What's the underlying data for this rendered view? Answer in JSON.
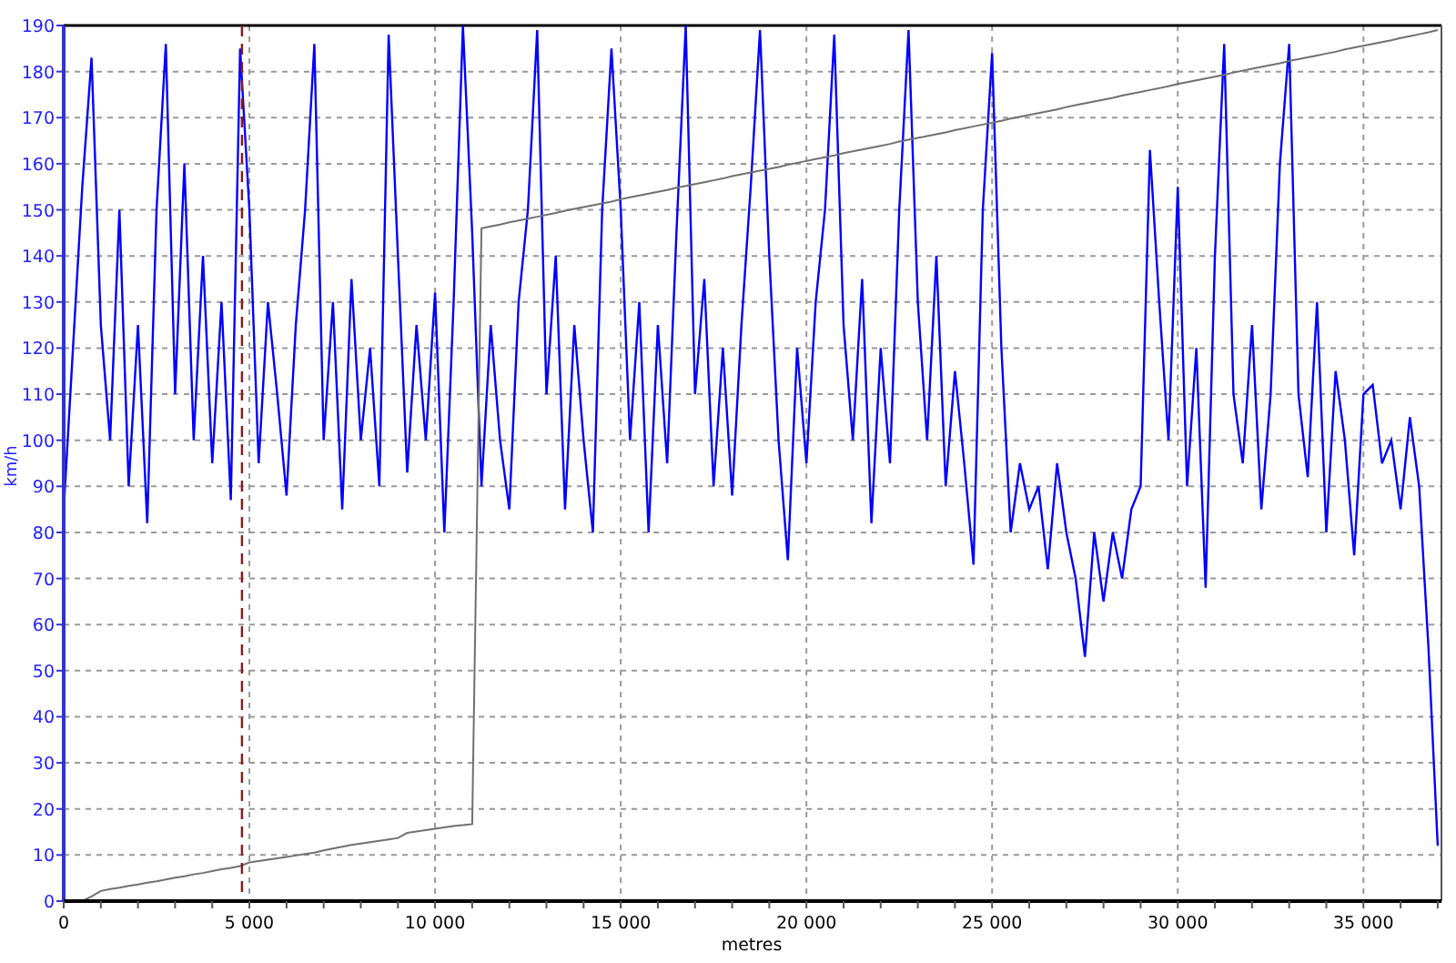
{
  "plot": {
    "chart_data": {
      "type": "line",
      "xlabel": "metres",
      "ylabel": "km/h",
      "xlim": [
        0,
        37100
      ],
      "ylim": [
        0,
        190
      ],
      "xticks": [
        {
          "value": 0,
          "label": "0"
        },
        {
          "value": 5000,
          "label": "5 000"
        },
        {
          "value": 10000,
          "label": "10 000"
        },
        {
          "value": 15000,
          "label": "15 000"
        },
        {
          "value": 20000,
          "label": "20 000"
        },
        {
          "value": 25000,
          "label": "25 000"
        },
        {
          "value": 30000,
          "label": "30 000"
        },
        {
          "value": 35000,
          "label": "35 000"
        }
      ],
      "yticks": [
        0,
        10,
        20,
        30,
        40,
        50,
        60,
        70,
        80,
        90,
        100,
        110,
        120,
        130,
        140,
        150,
        160,
        170,
        180,
        190
      ],
      "x": [
        0,
        250,
        500,
        750,
        1000,
        1250,
        1500,
        1750,
        2000,
        2250,
        2500,
        2750,
        3000,
        3250,
        3500,
        3750,
        4000,
        4250,
        4500,
        4750,
        5000,
        5250,
        5500,
        5750,
        6000,
        6250,
        6500,
        6750,
        7000,
        7250,
        7500,
        7750,
        8000,
        8250,
        8500,
        8750,
        9000,
        9250,
        9500,
        9750,
        10000,
        10250,
        10500,
        10750,
        11000,
        11250,
        11500,
        11750,
        12000,
        12250,
        12500,
        12750,
        13000,
        13250,
        13500,
        13750,
        14000,
        14250,
        14500,
        14750,
        15000,
        15250,
        15500,
        15750,
        16000,
        16250,
        16500,
        16750,
        17000,
        17250,
        17500,
        17750,
        18000,
        18250,
        18500,
        18750,
        19000,
        19250,
        19500,
        19750,
        20000,
        20250,
        20500,
        20750,
        21000,
        21250,
        21500,
        21750,
        22000,
        22250,
        22500,
        22750,
        23000,
        23250,
        23500,
        23750,
        24000,
        24250,
        24500,
        24750,
        25000,
        25250,
        25500,
        25750,
        26000,
        26250,
        26500,
        26750,
        27000,
        27250,
        27500,
        27750,
        28000,
        28250,
        28500,
        28750,
        29000,
        29250,
        29500,
        29750,
        30000,
        30250,
        30500,
        30750,
        31000,
        31250,
        31500,
        31750,
        32000,
        32250,
        32500,
        32750,
        33000,
        33250,
        33500,
        33750,
        34000,
        34250,
        34500,
        34750,
        35000,
        35250,
        35500,
        35750,
        36000,
        36250,
        36500,
        36750,
        37000
      ],
      "series": [
        {
          "color": "#0000ff",
          "values": [
            85,
            120,
            155,
            183,
            125,
            100,
            150,
            90,
            125,
            82,
            150,
            186,
            110,
            160,
            100,
            140,
            95,
            130,
            87,
            185,
            150,
            95,
            130,
            110,
            88,
            125,
            150,
            186,
            100,
            130,
            85,
            135,
            100,
            120,
            90,
            188,
            140,
            93,
            125,
            100,
            132,
            80,
            130,
            190,
            145,
            90,
            125,
            100,
            85,
            130,
            150,
            189,
            110,
            140,
            85,
            125,
            100,
            80,
            150,
            185,
            150,
            100,
            130,
            80,
            125,
            95,
            145,
            190,
            110,
            135,
            90,
            120,
            88,
            125,
            155,
            189,
            140,
            100,
            74,
            120,
            95,
            130,
            150,
            188,
            125,
            100,
            135,
            82,
            120,
            95,
            150,
            189,
            130,
            100,
            140,
            90,
            115,
            95,
            73,
            150,
            184,
            120,
            80,
            95,
            85,
            90,
            72,
            95,
            80,
            70,
            53,
            80,
            65,
            80,
            70,
            85,
            90,
            163,
            130,
            100,
            155,
            90,
            120,
            68,
            140,
            186,
            110,
            95,
            125,
            85,
            110,
            160,
            186,
            110,
            92,
            130,
            80,
            115,
            100,
            75,
            110,
            112,
            95,
            100,
            85,
            105,
            90,
            55,
            12
          ]
        },
        {
          "color": "#707070",
          "values": [
            0,
            0,
            0,
            1,
            2.2,
            2.6,
            2.9,
            3.3,
            3.6,
            4.0,
            4.3,
            4.7,
            5.1,
            5.4,
            5.8,
            6.1,
            6.5,
            6.9,
            7.2,
            7.6,
            8.4,
            8.7,
            9.0,
            9.3,
            9.6,
            9.9,
            10.2,
            10.5,
            11.0,
            11.4,
            11.8,
            12.2,
            12.5,
            12.8,
            13.1,
            13.4,
            13.7,
            14.8,
            15.1,
            15.4,
            15.7,
            16.0,
            16.3,
            16.5,
            16.7,
            146.0,
            146.4,
            146.8,
            147.3,
            147.7,
            148.1,
            148.5,
            148.9,
            149.3,
            149.8,
            150.2,
            150.6,
            151.0,
            151.4,
            151.8,
            152.3,
            152.7,
            153.1,
            153.5,
            153.9,
            154.3,
            154.8,
            155.2,
            155.6,
            156.0,
            156.4,
            156.8,
            157.3,
            157.7,
            158.1,
            158.5,
            158.9,
            159.3,
            159.8,
            160.2,
            160.6,
            161.0,
            161.4,
            161.8,
            162.3,
            162.7,
            163.1,
            163.5,
            163.9,
            164.3,
            164.8,
            165.2,
            165.6,
            166.0,
            166.4,
            166.8,
            167.3,
            167.7,
            168.1,
            168.5,
            168.9,
            169.3,
            169.8,
            170.2,
            170.6,
            171.0,
            171.4,
            171.8,
            172.3,
            172.7,
            173.1,
            173.5,
            173.9,
            174.3,
            174.8,
            175.2,
            175.6,
            176.0,
            176.4,
            176.8,
            177.3,
            177.7,
            178.1,
            178.5,
            178.9,
            179.3,
            179.8,
            180.2,
            180.6,
            181.0,
            181.4,
            181.8,
            182.3,
            182.7,
            183.1,
            183.5,
            183.9,
            184.3,
            184.8,
            185.2,
            185.6,
            186.0,
            186.4,
            186.8,
            187.3,
            187.7,
            188.1,
            188.5,
            189.0
          ]
        }
      ],
      "grid": true,
      "ref_lines": [
        {
          "axis": "x",
          "value": 4800
        }
      ]
    }
  }
}
